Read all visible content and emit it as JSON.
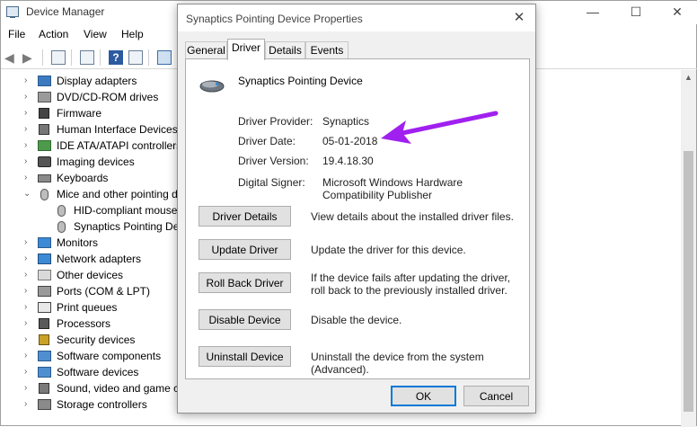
{
  "device_manager": {
    "title": "Device Manager",
    "window_controls": {
      "minimize": "—",
      "maximize": "☐",
      "close": "✕"
    },
    "menu": [
      "File",
      "Action",
      "View",
      "Help"
    ],
    "tree": [
      {
        "label": "Display adapters",
        "expanded": false,
        "icon": "display-adapter-icon"
      },
      {
        "label": "DVD/CD-ROM drives",
        "expanded": false,
        "icon": "dvd-drive-icon"
      },
      {
        "label": "Firmware",
        "expanded": false,
        "icon": "firmware-icon"
      },
      {
        "label": "Human Interface Devices",
        "expanded": false,
        "icon": "hid-icon"
      },
      {
        "label": "IDE ATA/ATAPI controllers",
        "expanded": false,
        "icon": "ide-controller-icon"
      },
      {
        "label": "Imaging devices",
        "expanded": false,
        "icon": "camera-icon"
      },
      {
        "label": "Keyboards",
        "expanded": false,
        "icon": "keyboard-icon"
      },
      {
        "label": "Mice and other pointing d",
        "expanded": true,
        "icon": "mouse-icon"
      },
      {
        "label": "HID-compliant mouse",
        "child": true,
        "icon": "mouse-icon"
      },
      {
        "label": "Synaptics Pointing Dev",
        "child": true,
        "icon": "mouse-icon"
      },
      {
        "label": "Monitors",
        "expanded": false,
        "icon": "monitor-icon"
      },
      {
        "label": "Network adapters",
        "expanded": false,
        "icon": "network-adapter-icon"
      },
      {
        "label": "Other devices",
        "expanded": false,
        "icon": "unknown-device-icon"
      },
      {
        "label": "Ports (COM & LPT)",
        "expanded": false,
        "icon": "port-icon"
      },
      {
        "label": "Print queues",
        "expanded": false,
        "icon": "printer-icon"
      },
      {
        "label": "Processors",
        "expanded": false,
        "icon": "processor-icon"
      },
      {
        "label": "Security devices",
        "expanded": false,
        "icon": "security-device-icon"
      },
      {
        "label": "Software components",
        "expanded": false,
        "icon": "software-component-icon"
      },
      {
        "label": "Software devices",
        "expanded": false,
        "icon": "software-device-icon"
      },
      {
        "label": "Sound, video and game co",
        "expanded": false,
        "icon": "speaker-icon"
      },
      {
        "label": "Storage controllers",
        "expanded": false,
        "icon": "storage-controller-icon"
      }
    ]
  },
  "dialog": {
    "title": "Synaptics Pointing Device Properties",
    "close_glyph": "✕",
    "tabs": [
      {
        "label": "General",
        "active": false
      },
      {
        "label": "Driver",
        "active": true
      },
      {
        "label": "Details",
        "active": false
      },
      {
        "label": "Events",
        "active": false
      }
    ],
    "device_name": "Synaptics Pointing Device",
    "properties": [
      {
        "label": "Driver Provider:",
        "value": "Synaptics"
      },
      {
        "label": "Driver Date:",
        "value": "05-01-2018"
      },
      {
        "label": "Driver Version:",
        "value": "19.4.18.30"
      },
      {
        "label": "Digital Signer:",
        "value": "Microsoft Windows Hardware Compatibility Publisher"
      }
    ],
    "actions": [
      {
        "button": "Driver Details",
        "description": "View details about the installed driver files."
      },
      {
        "button": "Update Driver",
        "description": "Update the driver for this device."
      },
      {
        "button": "Roll Back Driver",
        "description": "If the device fails after updating the driver, roll back to the previously installed driver."
      },
      {
        "button": "Disable Device",
        "description": "Disable the device."
      },
      {
        "button": "Uninstall Device",
        "description": "Uninstall the device from the system (Advanced)."
      }
    ],
    "ok_label": "OK",
    "cancel_label": "Cancel"
  },
  "colors": {
    "accent_blue": "#0078d7",
    "annotation_arrow": "#a020f0"
  }
}
